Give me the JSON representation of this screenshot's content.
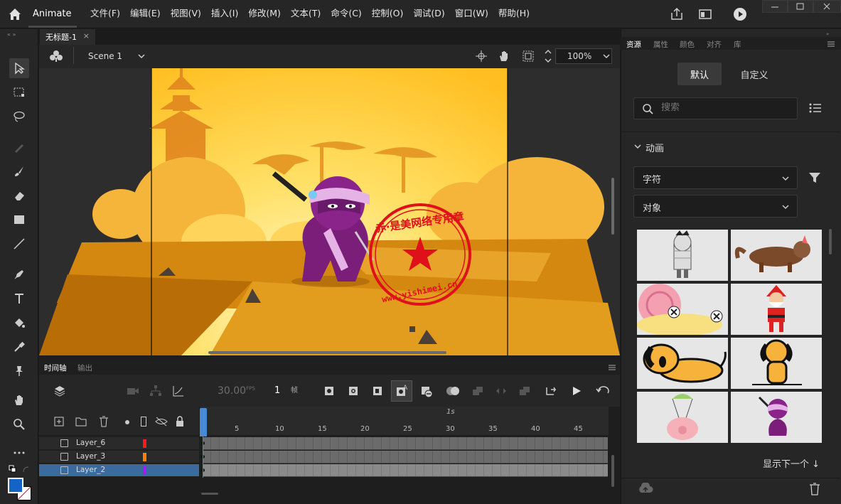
{
  "app": {
    "name": "Animate"
  },
  "menu": {
    "items": [
      "文件(F)",
      "编辑(E)",
      "视图(V)",
      "插入(I)",
      "修改(M)",
      "文本(T)",
      "命令(C)",
      "控制(O)",
      "调试(D)",
      "窗口(W)",
      "帮助(H)"
    ]
  },
  "document": {
    "tab_title": "无标题-1",
    "close_glyph": "×",
    "scene": "Scene 1",
    "zoom": "100%"
  },
  "timeline": {
    "tabs": [
      "时间轴",
      "输出"
    ],
    "fps_value": "30.00",
    "fps_unit": "FPS",
    "frame": "1",
    "frame_unit": "帧",
    "ruler_seconds": "1s",
    "ruler_ticks": [
      "5",
      "10",
      "15",
      "20",
      "25",
      "30",
      "35",
      "40",
      "45"
    ],
    "layers": [
      {
        "name": "Layer_6",
        "color": "#ff1a1a",
        "selected": false
      },
      {
        "name": "Layer_3",
        "color": "#ff8000",
        "selected": false
      },
      {
        "name": "Layer_2",
        "color": "#a020f0",
        "selected": true
      }
    ]
  },
  "assets_panel": {
    "tabs": [
      "资源",
      "属性",
      "颜色",
      "对齐",
      "库"
    ],
    "segments": [
      "默认",
      "自定义"
    ],
    "search_placeholder": "搜索",
    "section_title": "动画",
    "category_dropdown": "字符",
    "type_dropdown": "对象",
    "thumbnails": [
      "mummy-zombie",
      "wolf",
      "snail",
      "santa",
      "dog-lying",
      "dog-sitting",
      "pig-parachute",
      "ninja"
    ],
    "show_next": "显示下一个"
  },
  "stage": {
    "watermark_ring": "赤·是美网络专用章",
    "watermark_url": "www.yishimei.cn"
  },
  "colors": {
    "accent": "#4a8ad4",
    "fill_swatch": "#1464c8",
    "stage_sky": "#ffc83c",
    "ninja": "#8a1e8a"
  }
}
